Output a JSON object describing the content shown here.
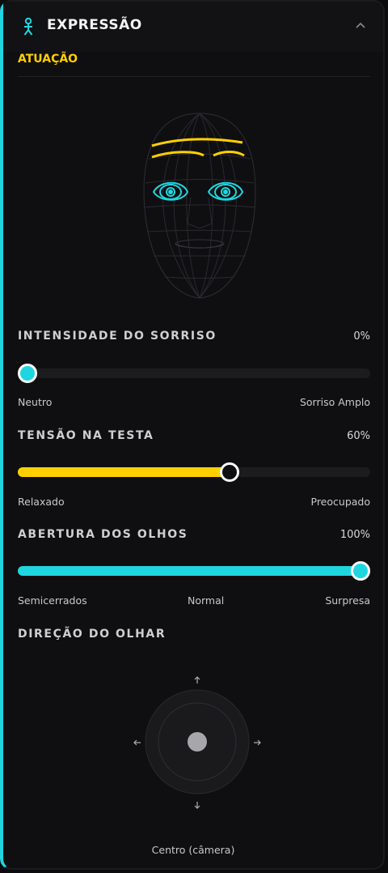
{
  "header": {
    "title": "EXPRESSÃO",
    "icon": "person-icon",
    "collapse_icon": "chevron-up-icon"
  },
  "section": {
    "label": "ATUAÇÃO"
  },
  "colors": {
    "accent_cyan": "#1fd6e0",
    "accent_yellow": "#ffd000",
    "track": "#1c1c1f"
  },
  "sliders": {
    "smile": {
      "label": "INTENSIDADE DO SORRISO",
      "value_text": "0%",
      "value": 0,
      "min_label": "Neutro",
      "max_label": "Sorriso Amplo"
    },
    "forehead": {
      "label": "TENSÃO NA TESTA",
      "value_text": "60%",
      "value": 60,
      "min_label": "Relaxado",
      "max_label": "Preocupado"
    },
    "eyes": {
      "label": "ABERTURA DOS OLHOS",
      "value_text": "100%",
      "value": 100,
      "min_label": "Semicerrados",
      "mid_label": "Normal",
      "max_label": "Surpresa"
    }
  },
  "gaze": {
    "label": "DIREÇÃO DO OLHAR",
    "caption": "Centro (câmera)",
    "x": 0,
    "y": 0
  }
}
